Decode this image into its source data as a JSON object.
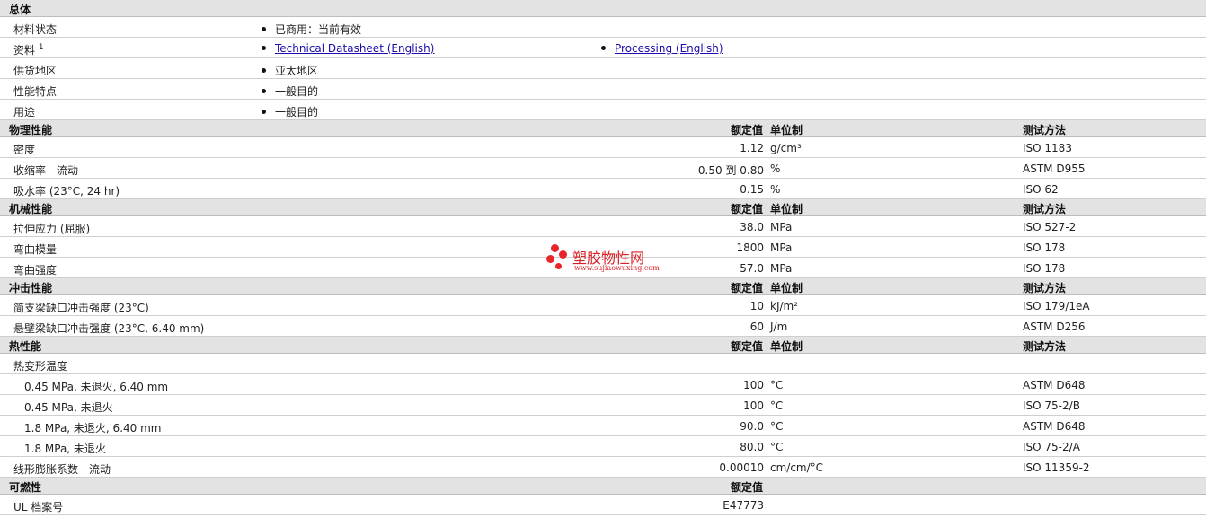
{
  "general": {
    "title": "总体",
    "rows": [
      {
        "label": "材料状态",
        "value": "已商用：当前有效"
      },
      {
        "label": "资料",
        "sup": "1",
        "link1": "Technical Datasheet (English)",
        "link2": "Processing (English)"
      },
      {
        "label": "供货地区",
        "value": "亚太地区"
      },
      {
        "label": "性能特点",
        "value": "一般目的"
      },
      {
        "label": "用途",
        "value": "一般目的"
      }
    ]
  },
  "headers": {
    "nominal": "额定值",
    "unit": "单位制",
    "method": "测试方法"
  },
  "physical": {
    "title": "物理性能",
    "rows": [
      {
        "label": "密度",
        "value": "1.12",
        "unit": "g/cm³",
        "method": "ISO 1183"
      },
      {
        "label": "收缩率 - 流动",
        "value": "0.50 到 0.80",
        "unit": "%",
        "method": "ASTM D955"
      },
      {
        "label": "吸水率 (23°C, 24 hr)",
        "value": "0.15",
        "unit": "%",
        "method": "ISO 62"
      }
    ]
  },
  "mechanical": {
    "title": "机械性能",
    "rows": [
      {
        "label": "拉伸应力 (屈服)",
        "value": "38.0",
        "unit": "MPa",
        "method": "ISO 527-2"
      },
      {
        "label": "弯曲模量",
        "value": "1800",
        "unit": "MPa",
        "method": "ISO 178"
      },
      {
        "label": "弯曲强度",
        "value": "57.0",
        "unit": "MPa",
        "method": "ISO 178"
      }
    ]
  },
  "impact": {
    "title": "冲击性能",
    "rows": [
      {
        "label": "简支梁缺口冲击强度 (23°C)",
        "value": "10",
        "unit": "kJ/m²",
        "method": "ISO 179/1eA"
      },
      {
        "label": "悬壁梁缺口冲击强度 (23°C, 6.40 mm)",
        "value": "60",
        "unit": "J/m",
        "method": "ASTM D256"
      }
    ]
  },
  "thermal": {
    "title": "热性能",
    "group_label": "热变形温度",
    "rows": [
      {
        "label": "0.45 MPa, 未退火, 6.40 mm",
        "value": "100",
        "unit": "°C",
        "method": "ASTM D648"
      },
      {
        "label": "0.45 MPa, 未退火",
        "value": "100",
        "unit": "°C",
        "method": "ISO 75-2/B"
      },
      {
        "label": "1.8 MPa, 未退火, 6.40 mm",
        "value": "90.0",
        "unit": "°C",
        "method": "ASTM D648"
      },
      {
        "label": "1.8 MPa, 未退火",
        "value": "80.0",
        "unit": "°C",
        "method": "ISO 75-2/A"
      }
    ],
    "cte": {
      "label": "线形膨胀系数 - 流动",
      "value": "0.00010",
      "unit": "cm/cm/°C",
      "method": "ISO 11359-2"
    }
  },
  "flammability": {
    "title": "可燃性",
    "rows": [
      {
        "label": "UL 档案号",
        "value": "E47773"
      }
    ]
  },
  "watermark": {
    "name": "塑胶物性网",
    "url": "www.sujiaowuxing.com",
    "color": "#e8252b"
  }
}
